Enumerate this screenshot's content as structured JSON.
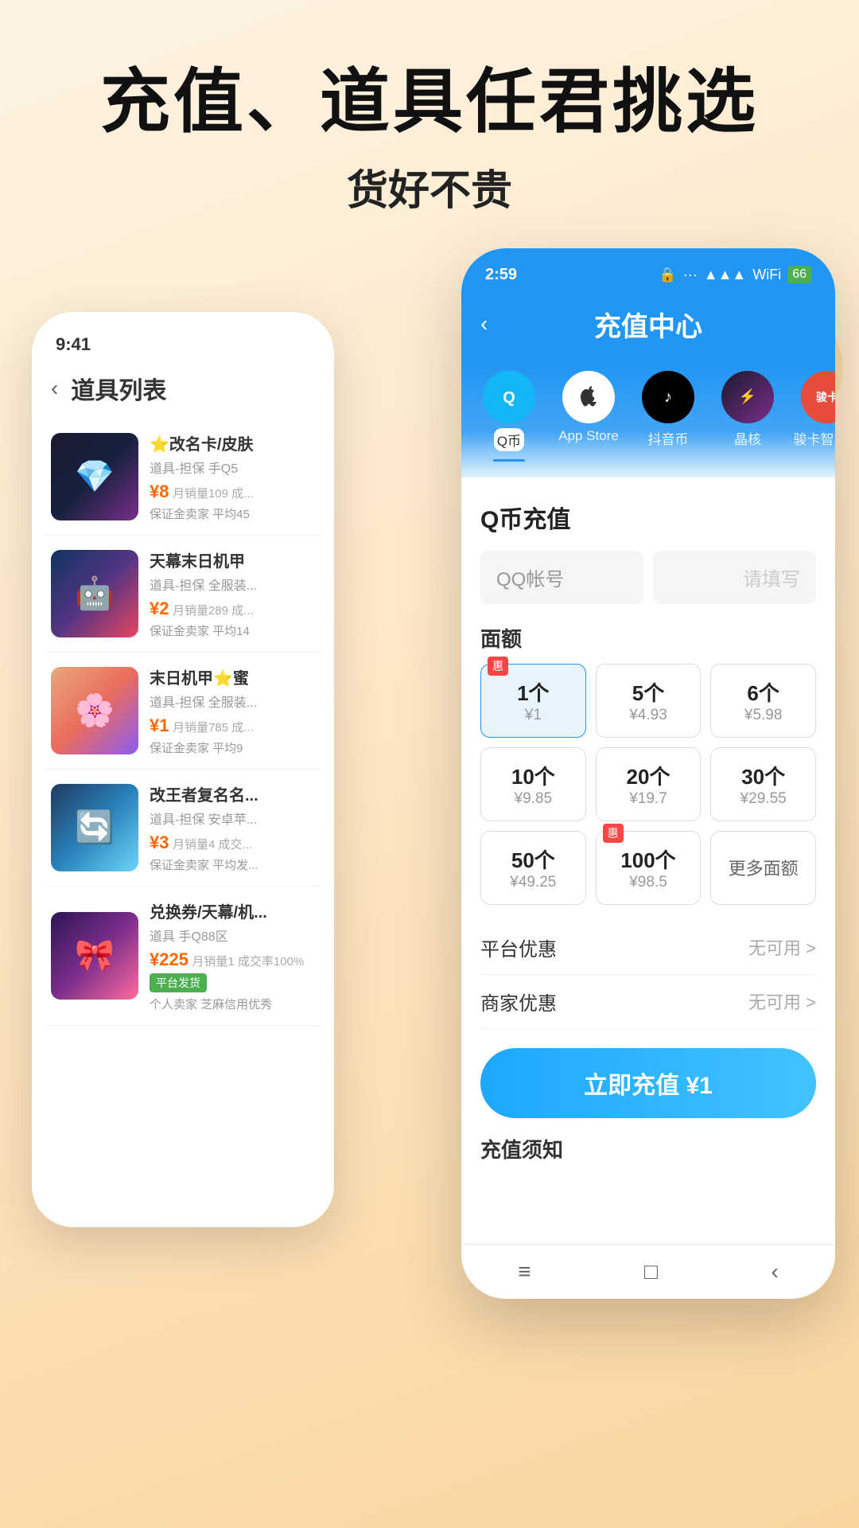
{
  "hero": {
    "title": "充值、道具任君挑选",
    "subtitle": "货好不贵"
  },
  "back_phone": {
    "status_time": "9:41",
    "header_title": "道具列表",
    "items": [
      {
        "id": 1,
        "name": "⭐改名卡/皮肤",
        "desc": "道具-担保 手Q5",
        "price": "¥8",
        "sales": "月销量109 成...",
        "guarantee": "保证金卖家 平均45",
        "img_class": "item-img-1",
        "emoji": "💎"
      },
      {
        "id": 2,
        "name": "天幕末日机甲",
        "desc": "道具-担保 全服装...",
        "price": "¥2",
        "sales": "月销量289 成...",
        "guarantee": "保证金卖家 平均14",
        "img_class": "item-img-2",
        "emoji": "🤖"
      },
      {
        "id": 3,
        "name": "末日机甲⭐蜜",
        "desc": "道具-担保 全服装...",
        "price": "¥1",
        "sales": "月销量785 成...",
        "guarantee": "保证金卖家 平均9",
        "img_class": "item-img-3",
        "emoji": "🌸"
      },
      {
        "id": 4,
        "name": "改王者复名名...",
        "desc": "道具-担保 安卓苹...",
        "price": "¥3",
        "sales": "月销量4 成交...",
        "guarantee": "保证金卖家 平均发...",
        "img_class": "item-img-4",
        "emoji": "🔄"
      },
      {
        "id": 5,
        "name": "兑换券/天幕/机...",
        "desc": "道具 手Q88区",
        "price": "¥225",
        "sales": "月销量1 成交率100%",
        "guarantee": "平台发货",
        "extra": "个人卖家 芝麻信用优秀",
        "img_class": "item-img-5",
        "emoji": "🎀",
        "has_platform_badge": true
      }
    ]
  },
  "front_phone": {
    "status_time": "2:59",
    "header_title": "充值中心",
    "tabs": [
      {
        "id": "qq",
        "label": "Q币",
        "icon": "Q",
        "active": true
      },
      {
        "id": "appstore",
        "label": "App Store",
        "icon": "🍎",
        "active": false
      },
      {
        "id": "tiktok",
        "label": "抖音币",
        "icon": "♪",
        "active": false
      },
      {
        "id": "jinghe",
        "label": "晶核",
        "icon": "⚡",
        "active": false
      },
      {
        "id": "junka",
        "label": "骏卡智充卡",
        "icon": "骏卡",
        "active": false
      }
    ],
    "section_title": "Q币充值",
    "input_label": "QQ帐号",
    "input_placeholder": "请填写",
    "amount_label": "面额",
    "amounts": [
      {
        "qty": "1个",
        "price": "¥1",
        "selected": true,
        "badge": "惠"
      },
      {
        "qty": "5个",
        "price": "¥4.93",
        "selected": false
      },
      {
        "qty": "6个",
        "price": "¥5.98",
        "selected": false
      },
      {
        "qty": "10个",
        "price": "¥9.85",
        "selected": false
      },
      {
        "qty": "20个",
        "price": "¥19.7",
        "selected": false
      },
      {
        "qty": "30个",
        "price": "¥29.55",
        "selected": false
      },
      {
        "qty": "50个",
        "price": "¥49.25",
        "selected": false
      },
      {
        "qty": "100个",
        "price": "¥98.5",
        "selected": false,
        "badge": "惠"
      },
      {
        "qty": "更多面额",
        "price": "",
        "is_more": true
      }
    ],
    "platform_promo": {
      "label": "平台优惠",
      "value": "无可用 >"
    },
    "merchant_promo": {
      "label": "商家优惠",
      "value": "无可用 >"
    },
    "charge_btn": "立即充值 ¥1",
    "notice_title": "充值须知",
    "bottom_nav": [
      "≡",
      "□",
      "‹"
    ]
  }
}
